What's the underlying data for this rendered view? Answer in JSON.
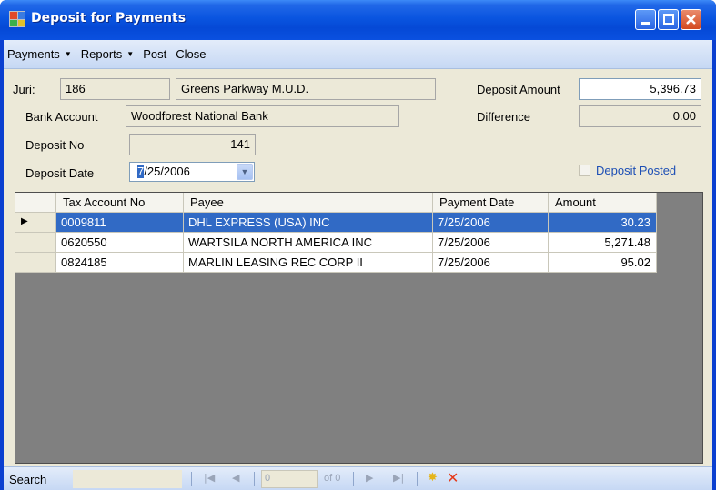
{
  "window": {
    "title": "Deposit for Payments"
  },
  "menu": {
    "items": [
      {
        "label": "Payments",
        "has_dropdown": true
      },
      {
        "label": "Reports",
        "has_dropdown": true
      },
      {
        "label": "Post",
        "has_dropdown": false
      },
      {
        "label": "Close",
        "has_dropdown": false
      }
    ]
  },
  "form": {
    "juri_label": "Juri:",
    "juri_code": "186",
    "juri_name": "Greens Parkway M.U.D.",
    "bank_account_label": "Bank Account",
    "bank_account_value": "Woodforest National Bank",
    "deposit_no_label": "Deposit No",
    "deposit_no_value": "141",
    "deposit_date_label": "Deposit Date",
    "deposit_date_selected": "7",
    "deposit_date_rest": "/25/2006",
    "deposit_amount_label": "Deposit Amount",
    "deposit_amount_value": "5,396.73",
    "difference_label": "Difference",
    "difference_value": "0.00",
    "deposit_posted_label": "Deposit Posted",
    "deposit_posted_checked": false
  },
  "grid": {
    "columns": [
      "Tax Account No",
      "Payee",
      "Payment Date",
      "Amount"
    ],
    "rows": [
      {
        "tax_account_no": "0009811",
        "payee": "DHL EXPRESS (USA) INC",
        "payment_date": "7/25/2006",
        "amount": "30.23",
        "selected": true
      },
      {
        "tax_account_no": "0620550",
        "payee": "WARTSILA NORTH AMERICA INC",
        "payment_date": "7/25/2006",
        "amount": "5,271.48",
        "selected": false
      },
      {
        "tax_account_no": "0824185",
        "payee": "MARLIN LEASING REC CORP II",
        "payment_date": "7/25/2006",
        "amount": "95.02",
        "selected": false
      }
    ]
  },
  "statusbar": {
    "search_label": "Search",
    "position_value": "0",
    "of_text": "of 0"
  },
  "colors": {
    "titlebar": "#0a55e0",
    "selection": "#316ac5",
    "grid_background": "#808080",
    "form_background": "#ece9d8",
    "link_text": "#1d4fb5"
  }
}
